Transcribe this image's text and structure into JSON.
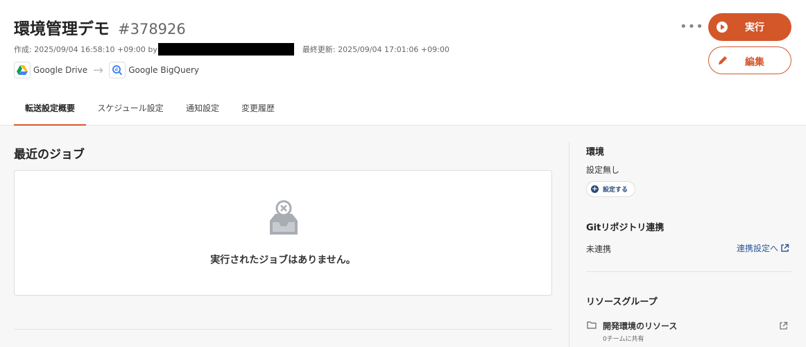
{
  "header": {
    "title": "環境管理デモ",
    "job_id": "#378926",
    "created_text": "作成: 2025/09/04 16:58:10 +09:00 by",
    "updated_text": "最終更新: 2025/09/04 17:01:06 +09:00",
    "source": "Google Drive",
    "destination": "Google BigQuery",
    "more_label": "•••",
    "run_label": "実行",
    "edit_label": "編集"
  },
  "tabs": [
    {
      "label": "転送設定概要",
      "active": true
    },
    {
      "label": "スケジュール設定",
      "active": false
    },
    {
      "label": "通知設定",
      "active": false
    },
    {
      "label": "変更履歴",
      "active": false
    }
  ],
  "main": {
    "section_title": "最近のジョブ",
    "empty_message": "実行されたジョブはありません。"
  },
  "sidebar": {
    "env_title": "環境",
    "env_value": "設定無し",
    "env_button": "設定する",
    "git_title": "Gitリポジトリ連携",
    "git_status": "未連携",
    "git_link": "連携設定へ",
    "rg_title": "リソースグループ",
    "rg_item_name": "開発環境のリソース",
    "rg_item_sub": "0チームに共有"
  },
  "colors": {
    "accent": "#d4572a",
    "link": "#2a5a9a"
  }
}
